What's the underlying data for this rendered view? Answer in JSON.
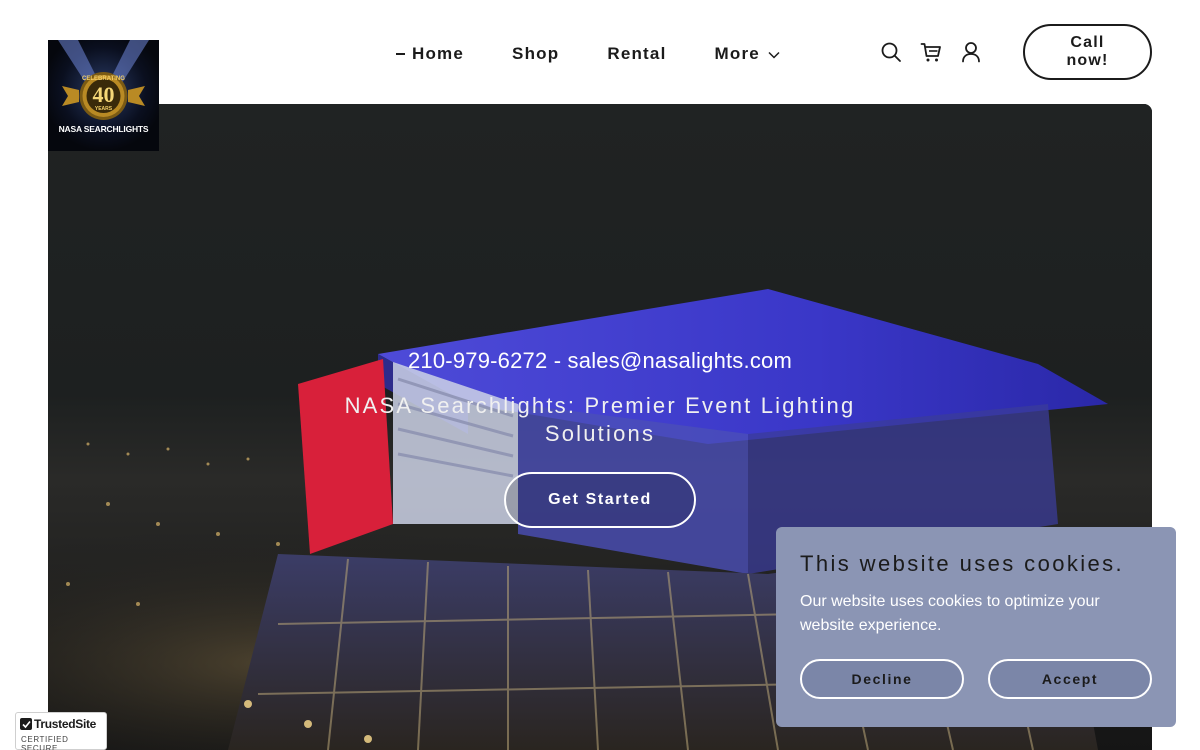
{
  "header": {
    "logo": {
      "badge_top": "CELEBRATING",
      "badge_number": "40",
      "badge_bottom": "YEARS",
      "name": "NASA SEARCHLIGHTS"
    },
    "nav": [
      {
        "label": "Home",
        "active": true
      },
      {
        "label": "Shop",
        "active": false
      },
      {
        "label": "Rental",
        "active": false
      },
      {
        "label": "More",
        "active": false,
        "has_dropdown": true
      }
    ],
    "icons": [
      "search-icon",
      "cart-icon",
      "account-icon"
    ],
    "cta_label": "Call now!"
  },
  "hero": {
    "contact": "210-979-6272 - sales@nasalights.com",
    "title": "NASA Searchlights: Premier Event Lighting Solutions",
    "cta_label": "Get Started"
  },
  "cookie_banner": {
    "title": "This website uses cookies.",
    "text": "Our website uses cookies to optimize your website experience.",
    "decline_label": "Decline",
    "accept_label": "Accept",
    "background": "#8b95b4"
  },
  "trust_badge": {
    "name": "TrustedSite",
    "subtitle": "CERTIFIED SECURE"
  },
  "colors": {
    "text": "#1b1b1b",
    "accent_red": "#e0203a",
    "accent_blue": "#3b39d9"
  }
}
